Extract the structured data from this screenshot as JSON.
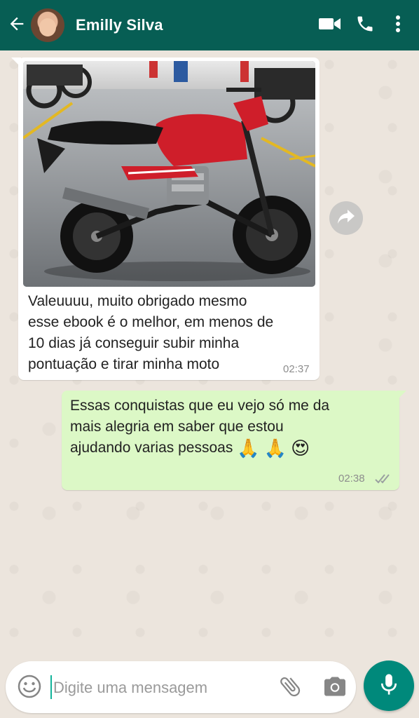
{
  "header": {
    "contact_name": "Emilly Silva",
    "background": "#075e54",
    "icons": [
      "back-arrow-icon",
      "video-call-icon",
      "phone-icon",
      "more-vert-icon"
    ]
  },
  "messages": [
    {
      "direction": "incoming",
      "has_image": true,
      "image_description": "red motorcycle",
      "text": "Valeuuuu, muito obrigado mesmo\nesse ebook é o melhor, em menos de\n10 dias já conseguir subir minha\npontuação e tirar minha moto",
      "time": "02:37"
    },
    {
      "direction": "outgoing",
      "text": "Essas conquistas que eu vejo só me da\nmais alegria em saber que estou\najudando varias pessoas",
      "emojis": [
        "🙏",
        "🙏",
        "😍"
      ],
      "time": "02:38",
      "status": "read"
    }
  ],
  "composer": {
    "placeholder": "Digite uma mensagem",
    "value": ""
  },
  "colors": {
    "outgoing_bubble": "#dcf8c6",
    "incoming_bubble": "#ffffff",
    "accent": "#00897b",
    "chat_background": "#ece5dd"
  }
}
